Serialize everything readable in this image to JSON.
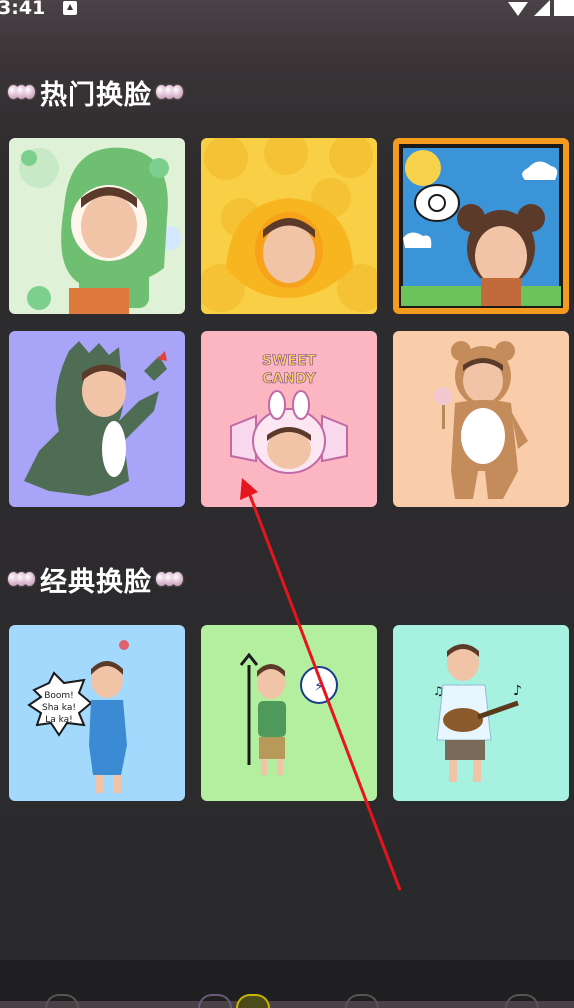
{
  "status_bar": {
    "time": "3:41"
  },
  "sections": {
    "hot": {
      "title": "热门换脸"
    },
    "classic": {
      "title": "经典换脸"
    }
  },
  "templates": {
    "hot": [
      {
        "name": "green-frog-hood",
        "bg": "#dff2d8"
      },
      {
        "name": "yellow-ducks",
        "bg": "#f8cf45"
      },
      {
        "name": "cartoon-sun-sky",
        "bg": "#3b93d8"
      },
      {
        "name": "green-dinosaur",
        "bg": "#a8a5f9"
      },
      {
        "name": "sweet-candy",
        "bg": "#fbb6c1",
        "label": "SWEET CANDY"
      },
      {
        "name": "brown-bear",
        "bg": "#f9ccaa"
      }
    ],
    "classic": [
      {
        "name": "boom-shaka-laka",
        "bg": "#a3d9fd",
        "bubble": "Boom! Sha ka! La ka!"
      },
      {
        "name": "devil-fork",
        "bg": "#b4ef9f"
      },
      {
        "name": "ukulele",
        "bg": "#a6f1df"
      }
    ]
  },
  "colors": {
    "background": "#2a2a2c",
    "annotation_arrow": "#e8141c"
  }
}
